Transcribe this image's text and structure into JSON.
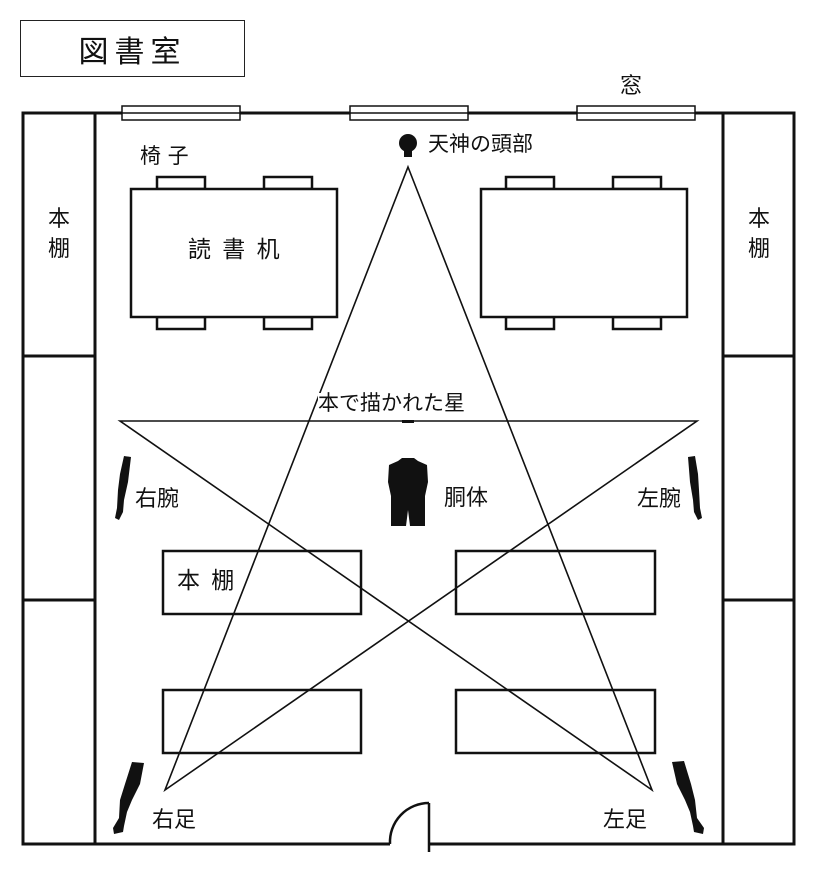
{
  "title": "図書室",
  "labels": {
    "window": "窓",
    "chair": "椅 子",
    "desk": "読 書 机",
    "head": "天神の頭部",
    "star": "本で描かれた星",
    "torso": "胴体",
    "right_arm": "右腕",
    "left_arm": "左腕",
    "right_leg": "右足",
    "left_leg": "左足",
    "shelf_center": "本 棚",
    "shelf_left_top": "本",
    "shelf_left_bottom": "棚",
    "shelf_right_top": "本",
    "shelf_right_bottom": "棚"
  },
  "icons": {
    "head": "head-icon",
    "torso": "torso-icon",
    "arm": "arm-icon",
    "leg": "leg-icon",
    "door": "door-icon"
  },
  "colors": {
    "ink": "#111111",
    "background": "#ffffff"
  }
}
